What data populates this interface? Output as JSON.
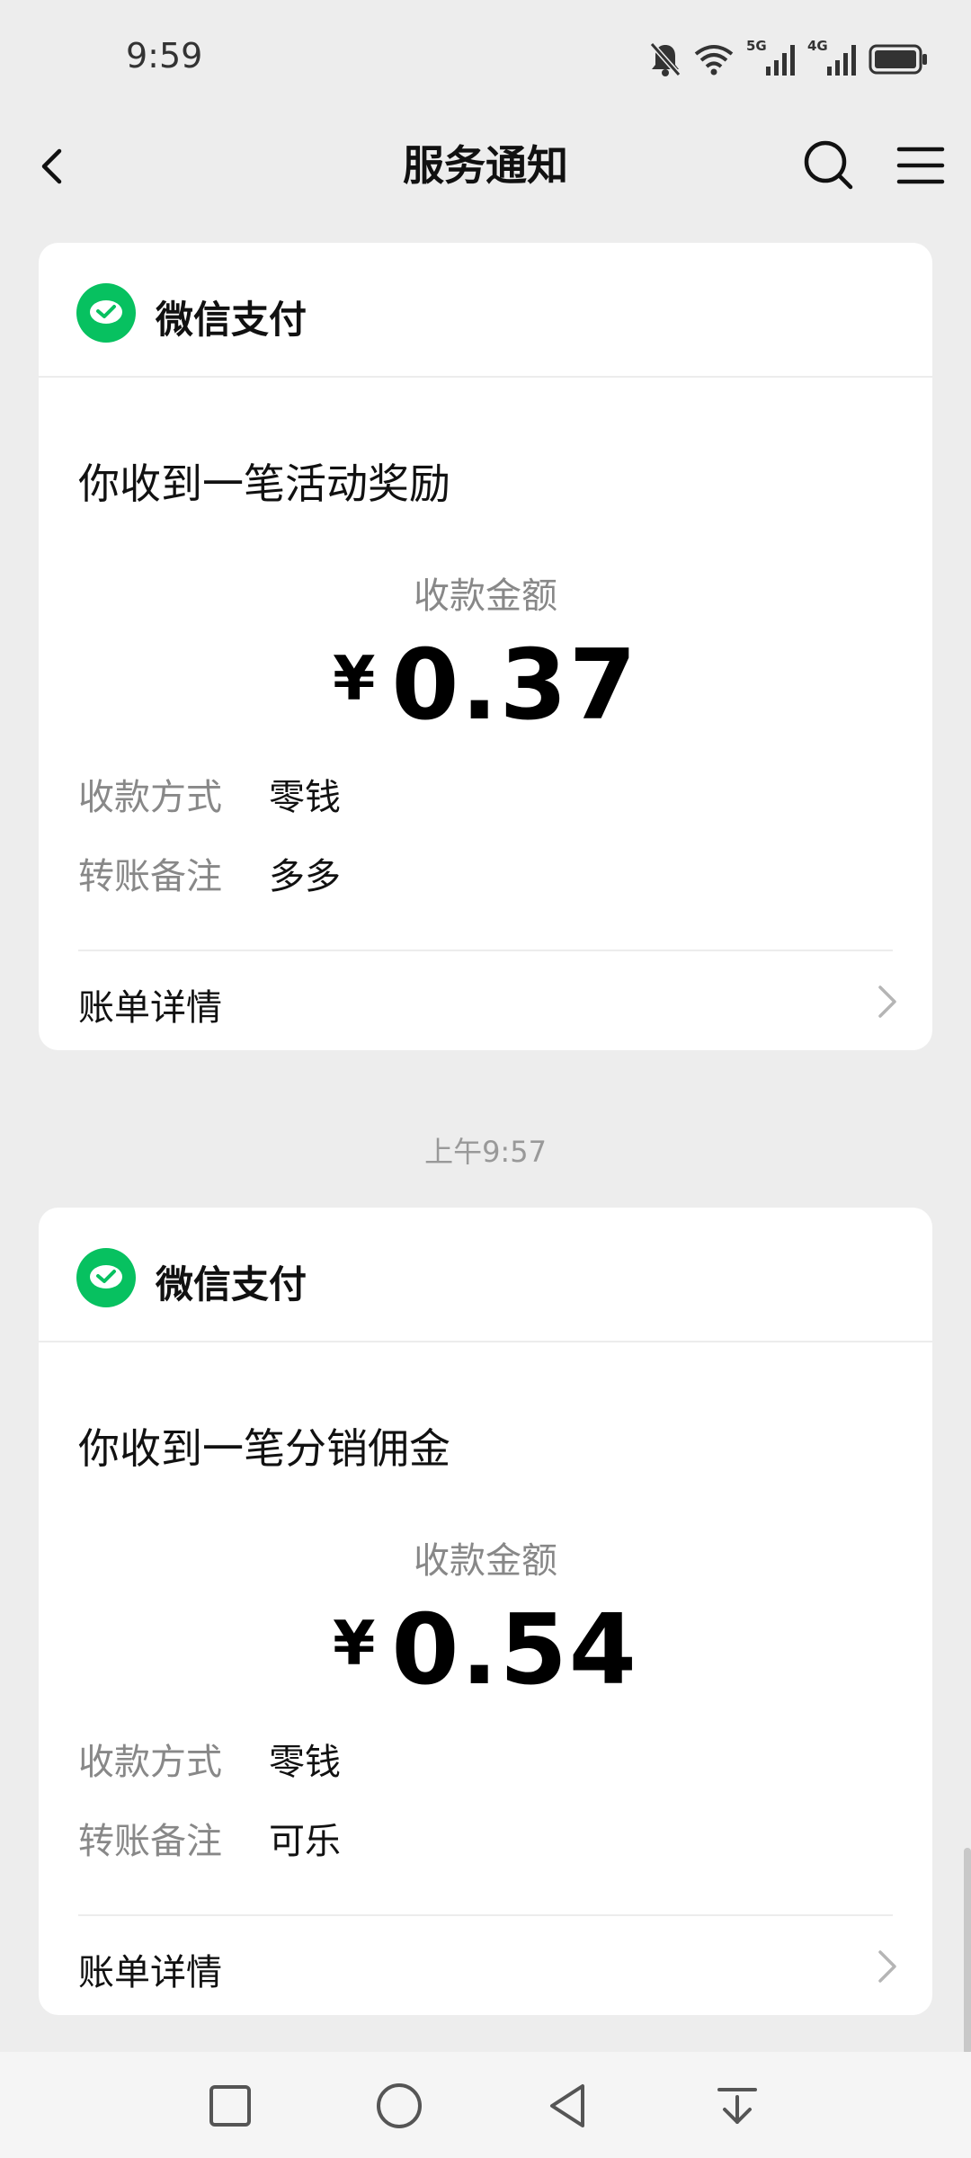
{
  "status_bar": {
    "time": "9:59",
    "network_5g": "5G",
    "network_4g": "4G"
  },
  "header": {
    "title": "服务通知"
  },
  "messages": [
    {
      "sender": "微信支付",
      "title": "你收到一笔活动奖励",
      "amount_label": "收款金额",
      "currency": "¥",
      "amount": "0.37",
      "rows": [
        {
          "key": "收款方式",
          "value": "零钱"
        },
        {
          "key": "转账备注",
          "value": "多多"
        }
      ],
      "detail_link": "账单详情"
    },
    {
      "timestamp": "上午9:57",
      "sender": "微信支付",
      "title": "你收到一笔分销佣金",
      "amount_label": "收款金额",
      "currency": "¥",
      "amount": "0.54",
      "rows": [
        {
          "key": "收款方式",
          "value": "零钱"
        },
        {
          "key": "转账备注",
          "value": "可乐"
        }
      ],
      "detail_link": "账单详情"
    }
  ],
  "colors": {
    "wechat_green": "#07c160",
    "background": "#ededed"
  },
  "icons": [
    "bell-off-icon",
    "wifi-icon",
    "signal-icon",
    "battery-icon",
    "back-icon",
    "search-icon",
    "menu-icon",
    "chevron-right-icon",
    "recent-apps-icon",
    "home-icon",
    "back-nav-icon",
    "notification-pull-icon"
  ]
}
